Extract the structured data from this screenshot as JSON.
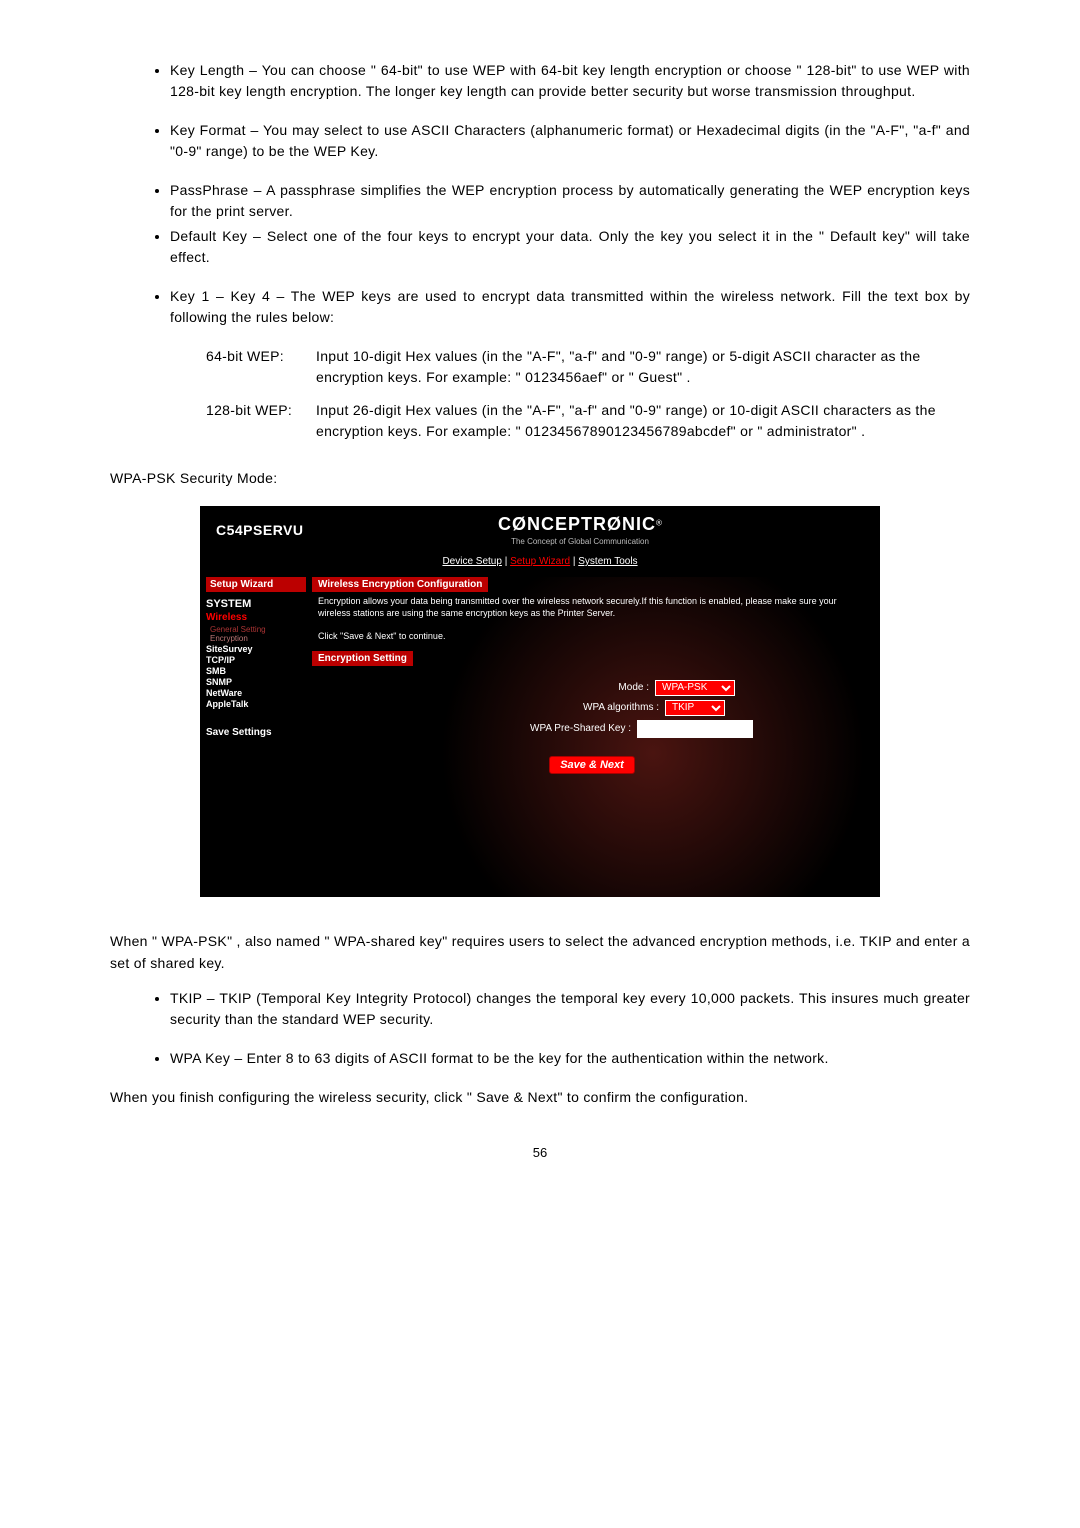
{
  "bullets_top": [
    "Key Length – You can choose \" 64-bit\" to use WEP with 64-bit key length encryption or choose \" 128-bit\" to use WEP with 128-bit key length encryption. The longer key length can provide better security but worse transmission throughput.",
    "Key Format – You may select to use ASCII Characters (alphanumeric format) or Hexadecimal digits (in the \"A-F\", \"a-f\" and \"0-9\" range) to be the WEP Key.",
    "PassPhrase – A passphrase simplifies the WEP encryption process by automatically generating the WEP encryption keys for the print server.",
    "Default Key – Select one of the four keys to encrypt your data. Only the key you select it in the \" Default key\" will take effect.",
    "Key 1 – Key 4 – The WEP keys are used to encrypt data transmitted within the wireless network. Fill the text box by following the rules below:"
  ],
  "wep": {
    "r1_label": "64-bit WEP:",
    "r1_text": "Input 10-digit Hex values (in the \"A-F\", \"a-f\" and \"0-9\" range) or 5-digit ASCII character as the encryption keys. For example: \" 0123456aef\" or \" Guest\" .",
    "r2_label": "128-bit WEP:",
    "r2_text": "Input 26-digit Hex values (in the \"A-F\", \"a-f\" and \"0-9\" range) or 10-digit ASCII characters as the encryption keys. For example: \" 01234567890123456789abcdef\" or \" administrator\" ."
  },
  "section_label": "WPA-PSK Security Mode:",
  "ui": {
    "product": "C54PSERVU",
    "logo": "CØNCEPTRØNIC",
    "logo_sup": "®",
    "tagline": "The Concept of Global Communication",
    "nav": {
      "a": "Device Setup",
      "b": "Setup Wizard",
      "c": "System Tools",
      "sep": " | "
    },
    "sidebar": {
      "setup": "Setup Wizard",
      "system": "SYSTEM",
      "wireless": "Wireless",
      "gen": "General Setting",
      "enc": "Encryption",
      "site": "SiteSurvey",
      "tcpip": "TCP/IP",
      "smb": "SMB",
      "snmp": "SNMP",
      "netware": "NetWare",
      "apple": "AppleTalk",
      "save": "Save Settings"
    },
    "panel_title": "Wireless Encryption Configuration",
    "desc1": "Encryption allows your data being transmitted over the wireless network securely.If this function is enabled, please make sure your wireless stations are using the same encryption keys as the Printer Server.",
    "desc2": "Click \"Save & Next\" to continue.",
    "enc_title": "Encryption Setting",
    "mode_label": "Mode :",
    "mode_value": "WPA-PSK",
    "algo_label": "WPA algorithms :",
    "algo_value": "TKIP",
    "psk_label": "WPA Pre-Shared Key :",
    "psk_value": "",
    "save_btn": "Save & Next"
  },
  "after": {
    "p1": "When \" WPA-PSK\" , also named \" WPA-shared key\" requires users to select the advanced encryption methods, i.e. TKIP and enter a set of shared key.",
    "li1": "TKIP – TKIP (Temporal Key Integrity Protocol) changes the temporal key every 10,000 packets. This insures much greater security than the standard WEP security.",
    "li2": "WPA Key – Enter 8 to 63 digits of ASCII format to be the key for the authentication within the network.",
    "p2": "When you finish configuring the wireless security, click \" Save & Next\" to confirm the configuration."
  },
  "page_number": "56"
}
